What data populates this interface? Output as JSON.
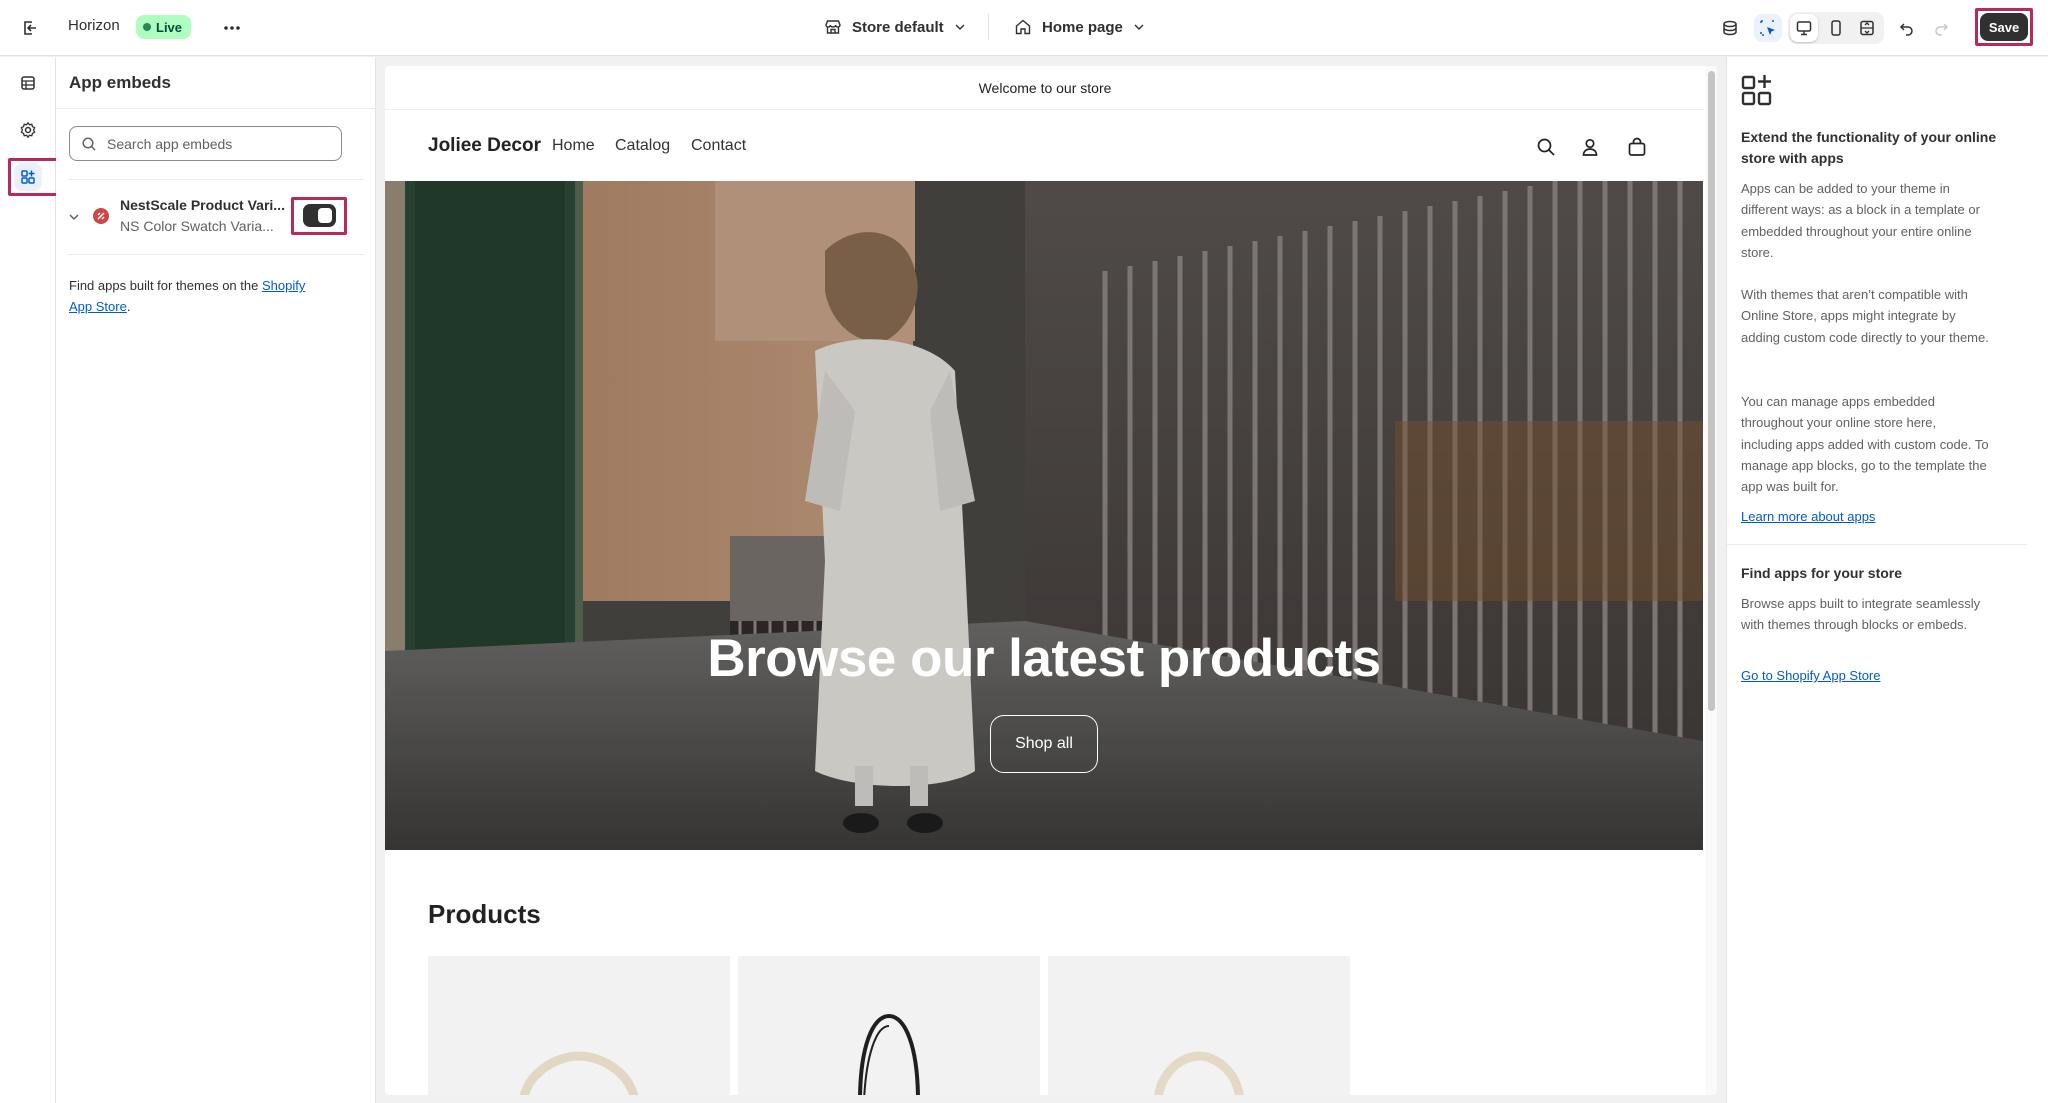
{
  "topbar": {
    "theme_name": "Horizon",
    "live_badge": "Live",
    "store_selector": "Store default",
    "page_selector": "Home page",
    "save_label": "Save"
  },
  "panel": {
    "title": "App embeds",
    "search_placeholder": "Search app embeds",
    "embed": {
      "name": "NestScale Product Vari...",
      "subtitle": "NS Color Swatch Varia...",
      "enabled": true
    },
    "find_text": "Find apps built for themes on the ",
    "find_link_1": "Shopify",
    "find_link_2": "App Store",
    "find_end": "."
  },
  "preview": {
    "announcement": "Welcome to our store",
    "store_name": "Joliee Decor",
    "nav": [
      "Home",
      "Catalog",
      "Contact"
    ],
    "hero_title": "Browse our latest products",
    "hero_button": "Shop all",
    "products_title": "Products"
  },
  "rpanel": {
    "heading": "Extend the functionality of your online store with apps",
    "p1": "Apps can be added to your theme in different ways: as a block in a template or embedded throughout your entire online store.",
    "p2": "With themes that aren’t compatible with Online Store, apps might integrate by adding custom code directly to your theme.",
    "p3": "You can manage apps embedded throughout your online store here, including apps added with custom code. To manage app blocks, go to the template the app was built for.",
    "learn_link": "Learn more about apps",
    "find_heading": "Find apps for your store",
    "find_p": "Browse apps built to integrate seamlessly with themes through blocks or embeds.",
    "store_link": "Go to Shopify App Store"
  },
  "colors": {
    "accent_outline": "#b8295e",
    "live_badge_bg": "#affebf",
    "link": "#005bd3"
  }
}
